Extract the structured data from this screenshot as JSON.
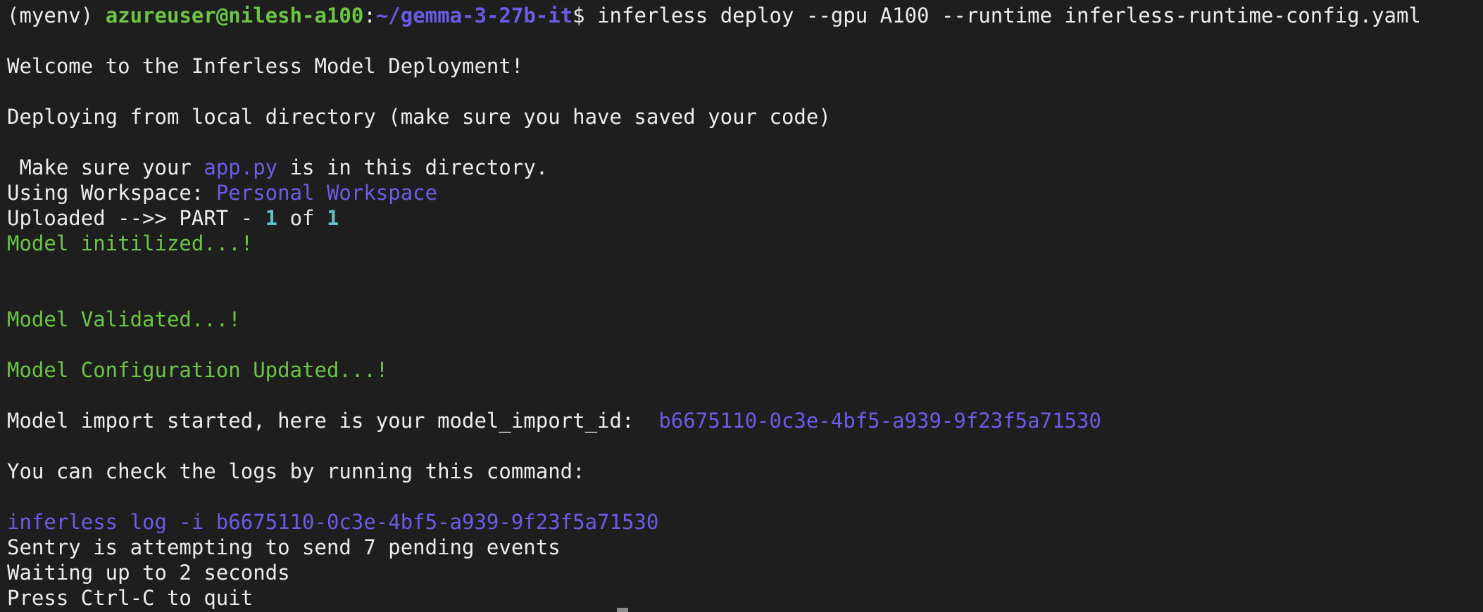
{
  "prompt": {
    "venv": "(myenv) ",
    "user_host": "azureuser@nilesh-a100",
    "colon": ":",
    "cwd": "~/gemma-3-27b-it",
    "symbol": "$ ",
    "command": "inferless deploy --gpu A100 --runtime inferless-runtime-config.yaml"
  },
  "output": {
    "welcome": "Welcome to the Inferless Model Deployment!",
    "deploying": "Deploying from local directory (make sure you have saved your code)",
    "make_sure_prefix": " Make sure your ",
    "make_sure_file": "app.py",
    "make_sure_suffix": " is in this directory.",
    "workspace_prefix": "Using Workspace: ",
    "workspace_name": "Personal Workspace",
    "uploaded_prefix": "Uploaded -->> PART - ",
    "uploaded_part": "1",
    "uploaded_of": " of ",
    "uploaded_total": "1",
    "initialized": "Model initilized...!",
    "validated": "Model Validated...!",
    "config_updated": "Model Configuration Updated...!",
    "import_prefix": "Model import started, here is your model_import_id:  ",
    "import_id": "b6675110-0c3e-4bf5-a939-9f23f5a71530",
    "check_logs": "You can check the logs by running this command:",
    "log_command": "inferless log -i b6675110-0c3e-4bf5-a939-9f23f5a71530",
    "sentry": "Sentry is attempting to send 7 pending events",
    "waiting": "Waiting up to 2 seconds",
    "quit": "Press Ctrl-C to quit"
  },
  "colors": {
    "background": "#1e1e1e",
    "text": "#ececec",
    "success": "#6cc644",
    "highlight": "#6c5ce8",
    "number": "#5fc3c9"
  }
}
